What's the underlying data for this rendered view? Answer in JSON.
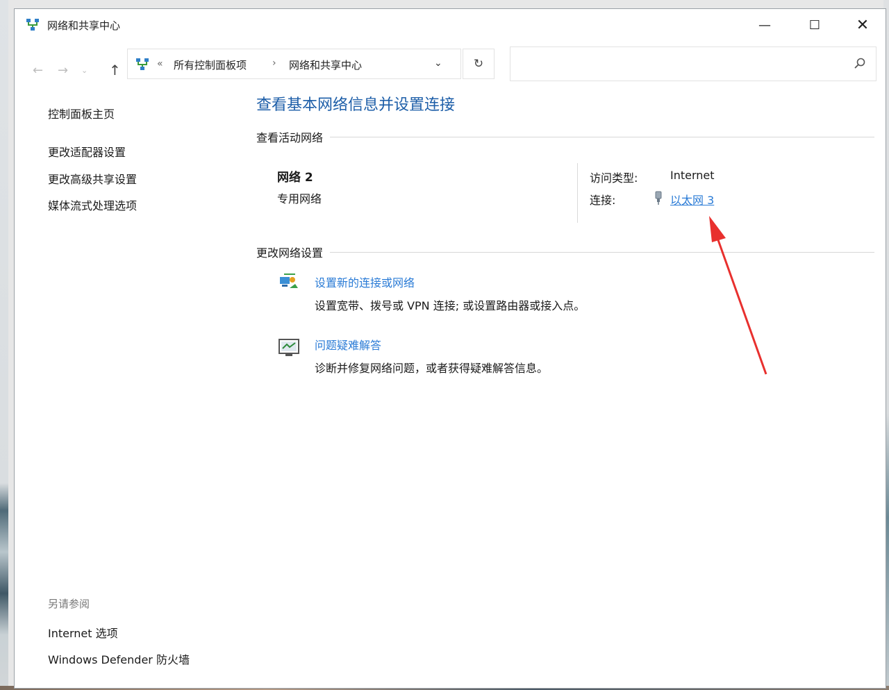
{
  "window": {
    "title": "网络和共享中心",
    "minimize_glyph": "—",
    "maximize_glyph": "☐",
    "close_glyph": "✕"
  },
  "address_bar": {
    "back_glyph": "←",
    "forward_glyph": "→",
    "recent_glyph": "⌄",
    "up_glyph": "↑",
    "overflow": "«",
    "crumbs": [
      "所有控制面板项",
      "网络和共享中心"
    ],
    "separator": "›",
    "dropdown_glyph": "⌄",
    "refresh_glyph": "↻",
    "search_placeholder": ""
  },
  "sidebar": {
    "items": [
      {
        "label": "控制面板主页"
      },
      {
        "label": "更改适配器设置"
      },
      {
        "label": "更改高级共享设置"
      },
      {
        "label": "媒体流式处理选项"
      }
    ],
    "see_also": {
      "heading": "另请参阅",
      "links": [
        {
          "label": "Internet 选项"
        },
        {
          "label": "Windows Defender 防火墙"
        }
      ]
    }
  },
  "main": {
    "title": "查看基本网络信息并设置连接",
    "active_networks_heading": "查看活动网络",
    "network": {
      "name": "网络 2",
      "profile": "专用网络",
      "access_type_label": "访问类型:",
      "access_type_value": "Internet",
      "connections_label": "连接:",
      "connection_link": "以太网 3"
    },
    "change_heading": "更改网络设置",
    "options": [
      {
        "icon": "network-setup-icon",
        "link": "设置新的连接或网络",
        "description": "设置宽带、拨号或 VPN 连接; 或设置路由器或接入点。"
      },
      {
        "icon": "troubleshoot-icon",
        "link": "问题疑难解答",
        "description": "诊断并修复网络问题，或者获得疑难解答信息。"
      }
    ]
  },
  "colors": {
    "link_blue": "#2a7bd6",
    "title_blue": "#1d5ea8",
    "annotation_red": "#e8302e"
  }
}
